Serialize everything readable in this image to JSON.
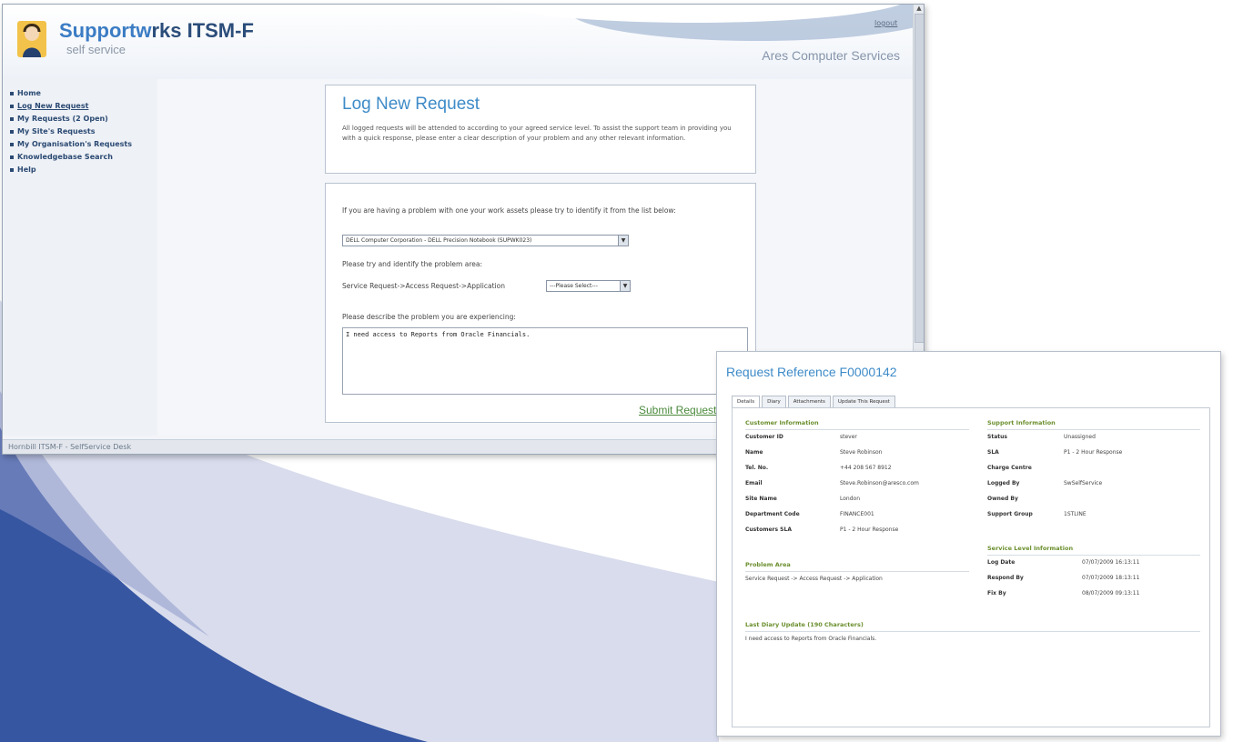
{
  "main_window": {
    "brand": {
      "name_part1": "Supportw",
      "name_part2": "rks ITSM-F",
      "subtitle": "self service"
    },
    "logout_label": "logout",
    "company": "Ares Computer Services",
    "nav": [
      {
        "label": "Home"
      },
      {
        "label": "Log New Request"
      },
      {
        "label": "My Requests (2 Open)"
      },
      {
        "label": "My Site's Requests"
      },
      {
        "label": "My Organisation's Requests"
      },
      {
        "label": "Knowledgebase Search"
      },
      {
        "label": "Help"
      }
    ],
    "footer": "Hornbill ITSM-F - SelfService Desk",
    "log_request": {
      "title": "Log New Request",
      "intro": "All logged requests will be attended to according to your agreed service level. To assist the support team in providing you with a quick response, please enter a clear description of your problem and any other relevant information."
    },
    "form": {
      "asset_prompt": "If you are having a problem with one your work assets please try to identify it from the list below:",
      "asset_selected": "DELL Computer Corporation - DELL Precision Notebook (SUPWK023)",
      "area_prompt": "Please try and identify the problem area:",
      "area_path": "Service Request->Access Request->Application",
      "area_selected": "---Please Select---",
      "describe_prompt": "Please describe the problem you are experiencing:",
      "description_value": "I need access to Reports from Oracle Financials.",
      "submit_label": "Submit Request"
    }
  },
  "detail_panel": {
    "title": "Request Reference F0000142",
    "tabs": [
      "Details",
      "Diary",
      "Attachments",
      "Update This Request"
    ],
    "customer_info": {
      "heading": "Customer Information",
      "rows": [
        {
          "label": "Customer ID",
          "value": "stever"
        },
        {
          "label": "Name",
          "value": "Steve Robinson"
        },
        {
          "label": "Tel. No.",
          "value": "+44 208 567 8912"
        },
        {
          "label": "Email",
          "value": "Steve.Robinson@aresco.com"
        },
        {
          "label": "Site Name",
          "value": "London"
        },
        {
          "label": "Department Code",
          "value": "FINANCE001"
        },
        {
          "label": "Customers SLA",
          "value": "P1 - 2 Hour Response"
        }
      ]
    },
    "support_info": {
      "heading": "Support Information",
      "rows": [
        {
          "label": "Status",
          "value": "Unassigned"
        },
        {
          "label": "SLA",
          "value": "P1 - 2 Hour Response"
        },
        {
          "label": "Charge Centre",
          "value": ""
        },
        {
          "label": "Logged By",
          "value": "SwSelfService"
        },
        {
          "label": "Owned By",
          "value": ""
        },
        {
          "label": "Support Group",
          "value": "1STLINE"
        }
      ]
    },
    "service_level": {
      "heading": "Service Level Information",
      "rows": [
        {
          "label": "Log Date",
          "value": "07/07/2009 16:13:11"
        },
        {
          "label": "Respond By",
          "value": "07/07/2009 18:13:11"
        },
        {
          "label": "Fix By",
          "value": "08/07/2009 09:13:11"
        }
      ]
    },
    "problem_area": {
      "heading": "Problem Area",
      "value": "Service Request -> Access Request -> Application"
    },
    "last_update": {
      "heading": "Last Diary Update (190 Characters)",
      "value": "I need access to Reports from Oracle Financials."
    }
  },
  "colors": {
    "accent_blue": "#3e8bc8",
    "section_green": "#6b8f2e",
    "decor_dark": "#3654a0",
    "decor_light": "#d5d9ea"
  }
}
